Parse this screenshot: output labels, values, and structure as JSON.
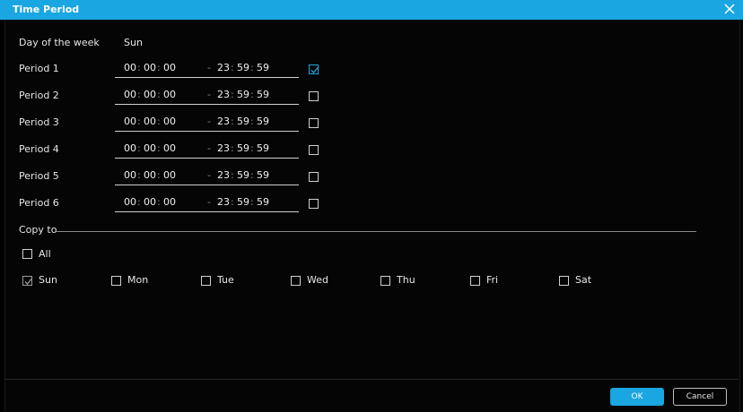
{
  "window": {
    "title": "Time Period",
    "close_icon": "close-icon"
  },
  "day_of_week": {
    "label": "Day of the week",
    "value": "Sun"
  },
  "periods": [
    {
      "label": "Period 1",
      "start": [
        "00",
        "00",
        "00"
      ],
      "end": [
        "23",
        "59",
        "59"
      ],
      "checked": true
    },
    {
      "label": "Period 2",
      "start": [
        "00",
        "00",
        "00"
      ],
      "end": [
        "23",
        "59",
        "59"
      ],
      "checked": false
    },
    {
      "label": "Period 3",
      "start": [
        "00",
        "00",
        "00"
      ],
      "end": [
        "23",
        "59",
        "59"
      ],
      "checked": false
    },
    {
      "label": "Period 4",
      "start": [
        "00",
        "00",
        "00"
      ],
      "end": [
        "23",
        "59",
        "59"
      ],
      "checked": false
    },
    {
      "label": "Period 5",
      "start": [
        "00",
        "00",
        "00"
      ],
      "end": [
        "23",
        "59",
        "59"
      ],
      "checked": false
    },
    {
      "label": "Period 6",
      "start": [
        "00",
        "00",
        "00"
      ],
      "end": [
        "23",
        "59",
        "59"
      ],
      "checked": false
    }
  ],
  "copy_to": {
    "label": "Copy to",
    "all_label": "All",
    "all_checked": false,
    "days": [
      {
        "label": "Sun",
        "checked": true
      },
      {
        "label": "Mon",
        "checked": false
      },
      {
        "label": "Tue",
        "checked": false
      },
      {
        "label": "Wed",
        "checked": false
      },
      {
        "label": "Thu",
        "checked": false
      },
      {
        "label": "Fri",
        "checked": false
      },
      {
        "label": "Sat",
        "checked": false
      }
    ]
  },
  "buttons": {
    "ok": "OK",
    "cancel": "Cancel"
  },
  "colors": {
    "accent": "#1aa6e0",
    "background": "#000000"
  }
}
